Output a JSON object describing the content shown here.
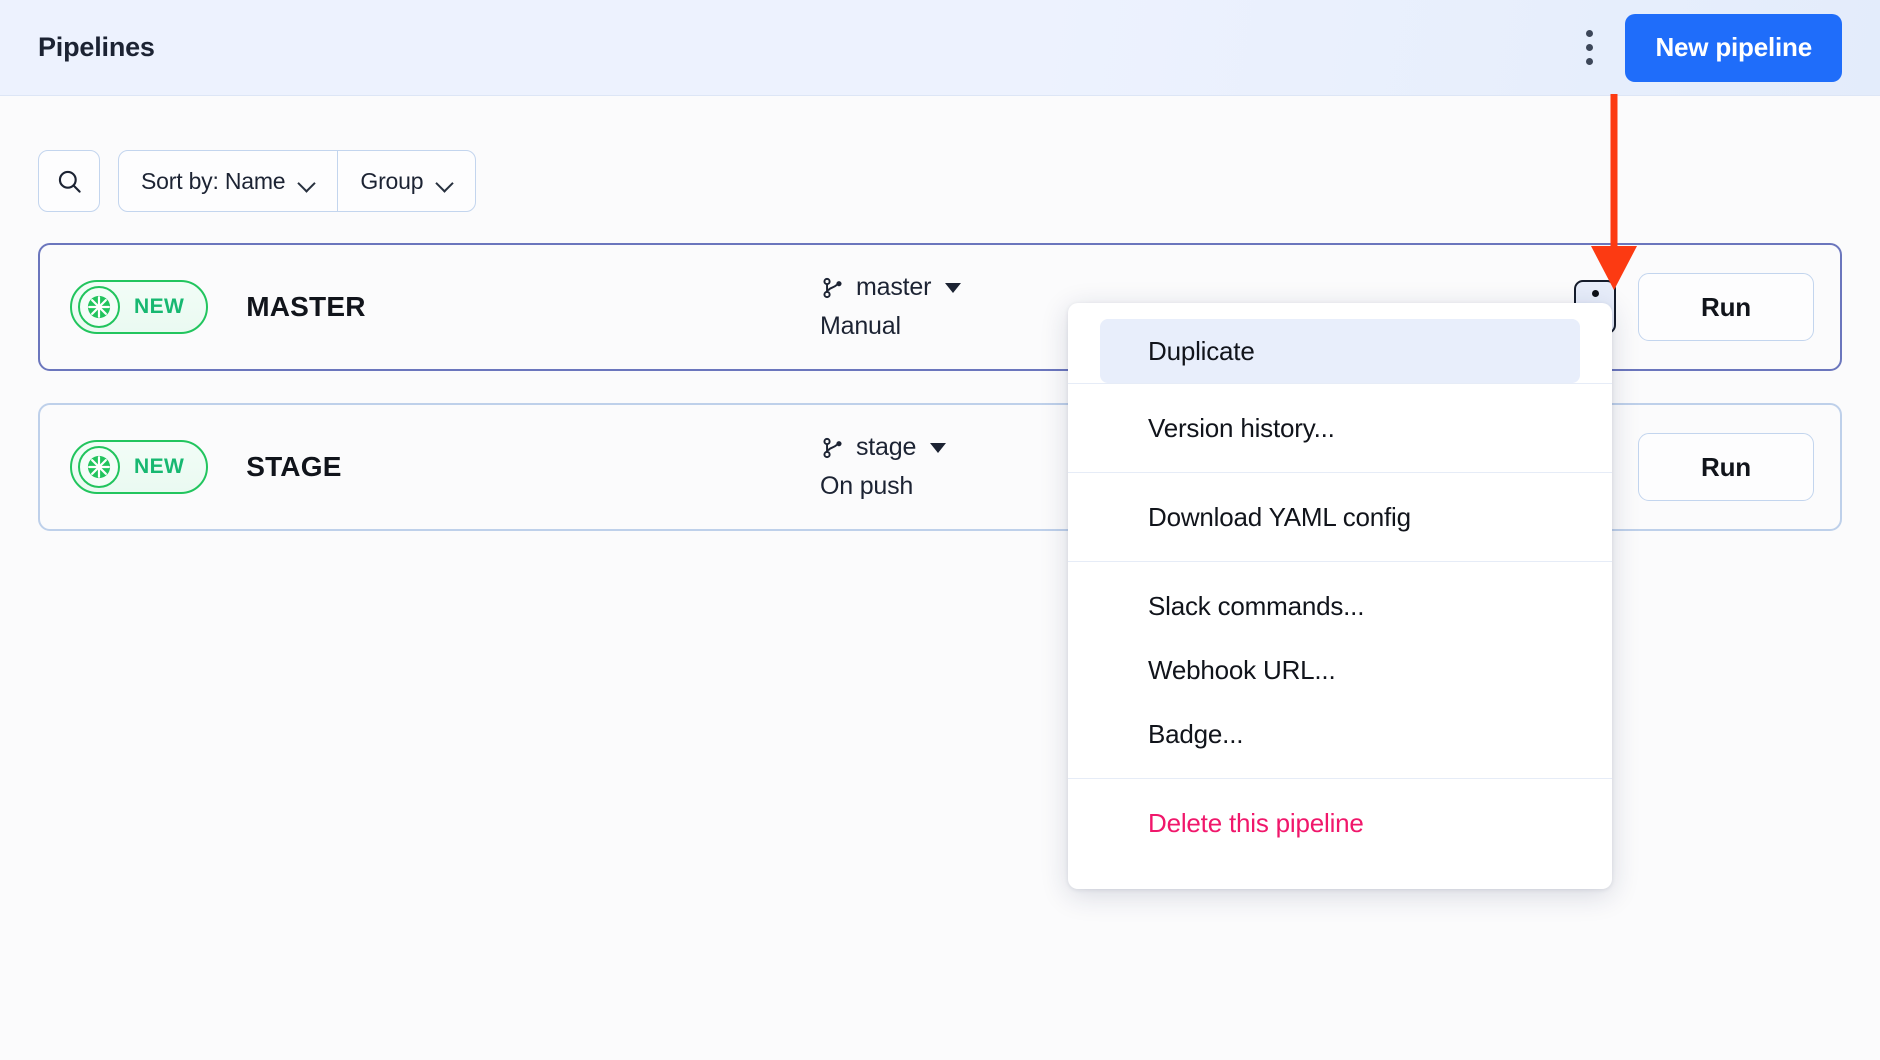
{
  "header": {
    "title": "Pipelines",
    "kebab_icon": "kebab-vertical-icon",
    "new_pipeline_label": "New pipeline"
  },
  "toolbar": {
    "search_icon": "search-icon",
    "sort_label": "Sort by: Name",
    "group_label": "Group",
    "chevron_icon": "chevron-down-icon"
  },
  "pipelines": [
    {
      "badge_label": "NEW",
      "badge_icon": "pipeline-status-icon",
      "name": "MASTER",
      "branch_icon": "git-branch-icon",
      "branch": "master",
      "trigger": "Manual",
      "run_label": "Run",
      "kebab_icon": "kebab-vertical-icon",
      "kebab_active": true
    },
    {
      "badge_label": "NEW",
      "badge_icon": "pipeline-status-icon",
      "name": "STAGE",
      "branch_icon": "git-branch-icon",
      "branch": "stage",
      "trigger": "On push",
      "run_label": "Run",
      "kebab_icon": "kebab-vertical-icon",
      "kebab_active": false
    }
  ],
  "context_menu": {
    "sections": [
      {
        "items": [
          {
            "label": "Duplicate",
            "hovered": true
          }
        ]
      },
      {
        "items": [
          {
            "label": "Version history...",
            "hovered": false
          }
        ]
      },
      {
        "items": [
          {
            "label": "Download YAML config",
            "hovered": false
          }
        ]
      },
      {
        "items": [
          {
            "label": "Slack commands...",
            "hovered": false
          },
          {
            "label": "Webhook URL...",
            "hovered": false
          },
          {
            "label": "Badge...",
            "hovered": false
          }
        ]
      },
      {
        "items": [
          {
            "label": "Delete this pipeline",
            "hovered": false,
            "danger": true
          }
        ]
      }
    ]
  },
  "annotation": {
    "arrow_icon": "red-down-arrow-annotation",
    "color": "#fc3a12"
  },
  "colors": {
    "accent_blue": "#1f6dfa",
    "header_bg": "#edf2fe",
    "badge_green": "#22c55e",
    "danger_pink": "#f0176b",
    "card_active_border": "#6b76bd",
    "card_border": "#bed0ea"
  }
}
